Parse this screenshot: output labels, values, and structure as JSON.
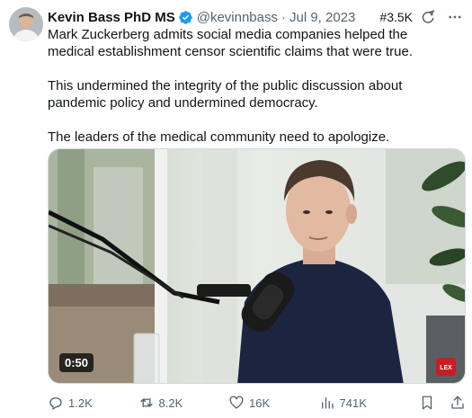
{
  "author": {
    "name": "Kevin Bass PhD MS",
    "handle": "@kevinnbass",
    "separator": "·",
    "date": "Jul 9, 2023",
    "verified": true,
    "avatar_icon": "avatar-photo"
  },
  "badge": "#3.5K",
  "tweet": {
    "paragraphs": [
      "Mark Zuckerberg admits social media companies helped the medical establishment censor scientific claims that were true.",
      "This undermined the integrity of the public discussion about pandemic policy and undermined democracy.",
      "The leaders of the medical community need to apologize."
    ]
  },
  "media": {
    "type": "video",
    "duration": "0:50",
    "watermark": "LEX"
  },
  "actions": {
    "replies": "1.2K",
    "reposts": "8.2K",
    "likes": "16K",
    "views": "741K"
  },
  "colors": {
    "text": "#0f1419",
    "secondary": "#536471",
    "verified": "#1d9bf0"
  }
}
